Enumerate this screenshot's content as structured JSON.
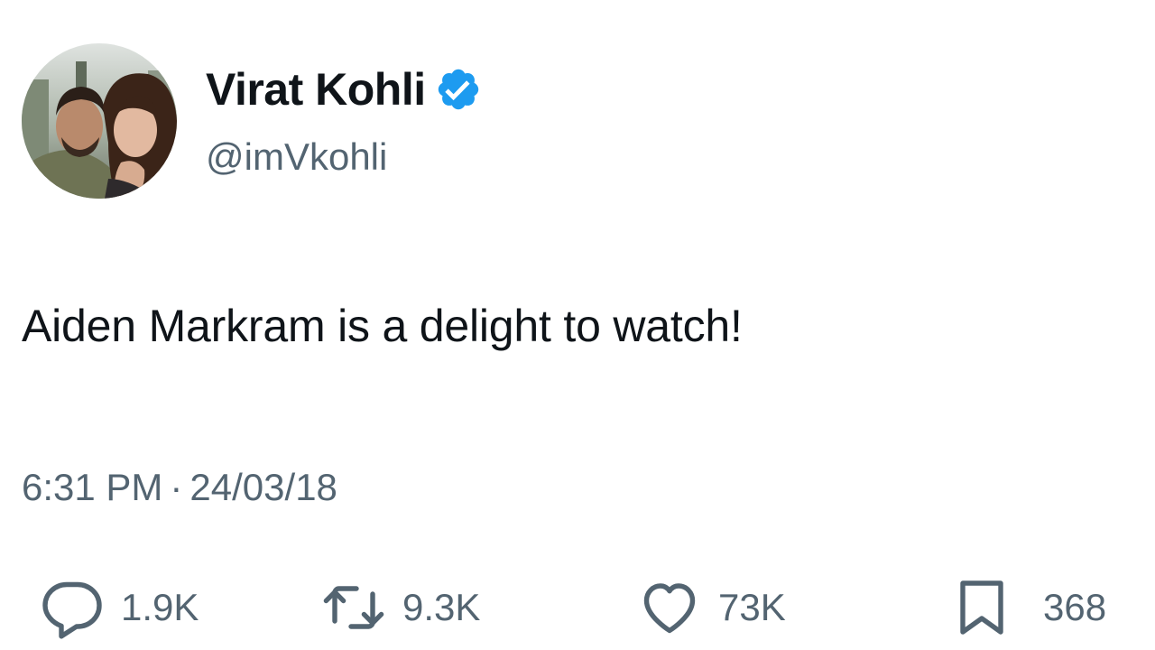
{
  "author": {
    "display_name": "Virat Kohli",
    "handle": "@imVkohli",
    "verified": true
  },
  "tweet": {
    "text": "Aiden Markram is a delight to watch!",
    "time": "6:31 PM",
    "separator": "·",
    "date": "24/03/18"
  },
  "actions": {
    "reply": {
      "icon": "reply-icon",
      "count": "1.9K"
    },
    "retweet": {
      "icon": "retweet-icon",
      "count": "9.3K"
    },
    "like": {
      "icon": "heart-icon",
      "count": "73K"
    },
    "bookmark": {
      "icon": "bookmark-icon",
      "count": "368"
    }
  },
  "colors": {
    "text_primary": "#0f1419",
    "text_secondary": "#536471",
    "verified_blue": "#1d9bf0",
    "background": "#ffffff"
  }
}
